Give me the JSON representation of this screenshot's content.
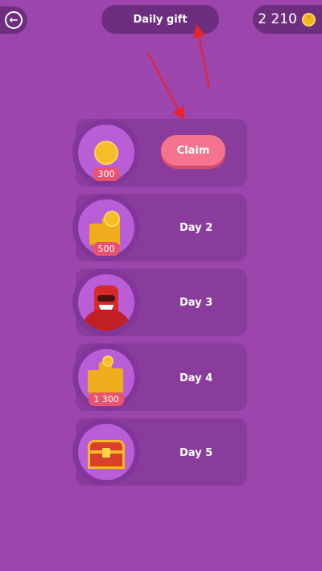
{
  "header": {
    "back_icon": "back-arrow-icon",
    "title": "Daily gift",
    "balance": "2 210",
    "coin_icon": "coin-icon"
  },
  "rewards": [
    {
      "badge": "300",
      "action_label": "Claim",
      "icon": "coin-icon"
    },
    {
      "badge": "500",
      "label": "Day 2",
      "icon": "coin-stacks-icon"
    },
    {
      "label": "Day 3",
      "icon": "character-icon"
    },
    {
      "badge": "1 300",
      "label": "Day 4",
      "icon": "coin-pile-icon"
    },
    {
      "label": "Day 5",
      "icon": "treasure-chest-icon"
    }
  ],
  "colors": {
    "background": "#9b45ad",
    "panel": "#8a3c9c",
    "claim": "#f4738f",
    "annotation": "#e8232d"
  }
}
